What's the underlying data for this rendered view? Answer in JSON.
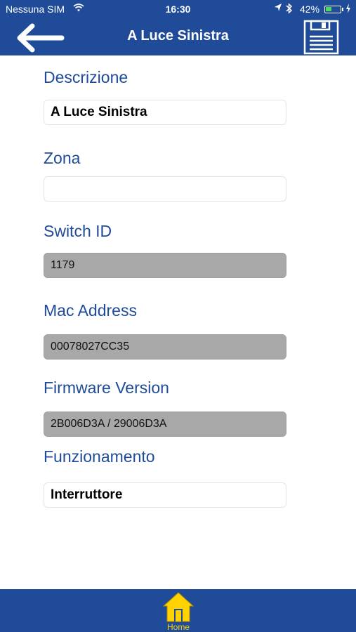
{
  "status_bar": {
    "carrier": "Nessuna SIM",
    "time": "16:30",
    "battery_percent": "42%",
    "battery_level": 0.42,
    "icons": [
      "wifi-icon",
      "location-icon",
      "bluetooth-icon",
      "battery-icon",
      "charging-icon"
    ]
  },
  "nav": {
    "title": "A Luce Sinistra",
    "back_icon": "arrow-left-icon",
    "save_icon": "floppy-save-icon"
  },
  "form": {
    "descrizione": {
      "label": "Descrizione",
      "value": "A Luce Sinistra"
    },
    "zona": {
      "label": "Zona",
      "value": ""
    },
    "switch_id": {
      "label": "Switch ID",
      "value": "1179"
    },
    "mac_address": {
      "label": "Mac Address",
      "value": "00078027CC35"
    },
    "firmware_version": {
      "label": "Firmware Version",
      "value": "2B006D3A / 29006D3A"
    },
    "funzionamento": {
      "label": "Funzionamento",
      "value": "Interruttore"
    }
  },
  "tab_bar": {
    "home_label": "Home",
    "home_icon": "home-icon"
  },
  "colors": {
    "primary": "#1f4b99",
    "label": "#1f4b99",
    "readonly_field": "#a8a8a8",
    "home_accent": "#ffd200"
  }
}
